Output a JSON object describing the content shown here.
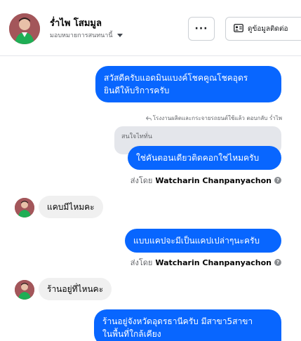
{
  "header": {
    "contact_name": "ร่ำไพ โสมมูล",
    "assign_label": "มอบหมายการสนทนานี้",
    "more_label": "···",
    "contact_info_label": "ดูข้อมูลติดต่อ"
  },
  "messages": [
    {
      "id": "m1",
      "direction": "out",
      "lines": [
        "สวัสดีครับแอดมินแบงค์โชคคูณโชคอุดร",
        "ยินดีให้บริการครับ"
      ]
    },
    {
      "id": "m2",
      "direction": "out",
      "reply_note": "โรงงานผลิตและกระจายรถยนต์ใช้แล้ว ตอบกลับ ร่ำไพ",
      "quoted_text": "สนใจไททั่น",
      "text": "ใช่คันตอนเดียวติดคอกใช่ไหมครับ",
      "sent_by_label": "ส่งโดย",
      "sent_by_name": "Watcharin Chanpanyachon"
    },
    {
      "id": "m3",
      "direction": "in",
      "text": "แคบมีไหมคะ"
    },
    {
      "id": "m4",
      "direction": "out",
      "text": "แบบแคปจะมีเป็นแคปเปล่าๆนะครับ",
      "sent_by_label": "ส่งโดย",
      "sent_by_name": "Watcharin Chanpanyachon"
    },
    {
      "id": "m5",
      "direction": "in",
      "text": "ร้านอยู่ที่ไหนคะ"
    },
    {
      "id": "m6",
      "direction": "out",
      "lines": [
        "ร้านอยู่จังหวัดอุดรธานีครับ มีสาขา5สาขา",
        "ในพื้นที่ใกล้เคียง"
      ]
    }
  ],
  "help_glyph": "?",
  "colors": {
    "outgoing_bubble": "#0866ff",
    "incoming_bubble": "#f0f0f0",
    "meta_text": "#65676b"
  }
}
